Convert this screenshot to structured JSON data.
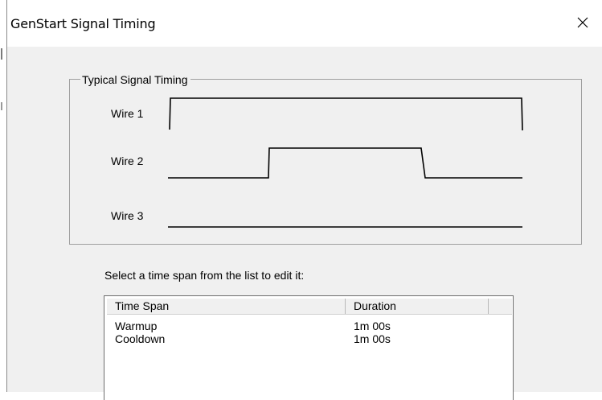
{
  "window": {
    "title": "GenStart Signal Timing",
    "close_label": "close"
  },
  "group": {
    "label": "Typical Signal Timing",
    "wires": [
      {
        "label": "Wire 1",
        "signal": "high for full span"
      },
      {
        "label": "Wire 2",
        "signal": "low, high, low"
      },
      {
        "label": "Wire 3",
        "signal": "low for full span"
      }
    ]
  },
  "instruction": "Select a time span from the list to edit it:",
  "list": {
    "columns": [
      "Time Span",
      "Duration",
      ""
    ],
    "rows": [
      {
        "span": "Warmup",
        "duration": "1m 00s"
      },
      {
        "span": "Cooldown",
        "duration": "1m 00s"
      }
    ]
  },
  "colors": {
    "dialog_bg": "#f0f0f0",
    "titlebar_bg": "#ffffff",
    "group_border": "#a0a0a0",
    "signal_line": "#000000"
  }
}
